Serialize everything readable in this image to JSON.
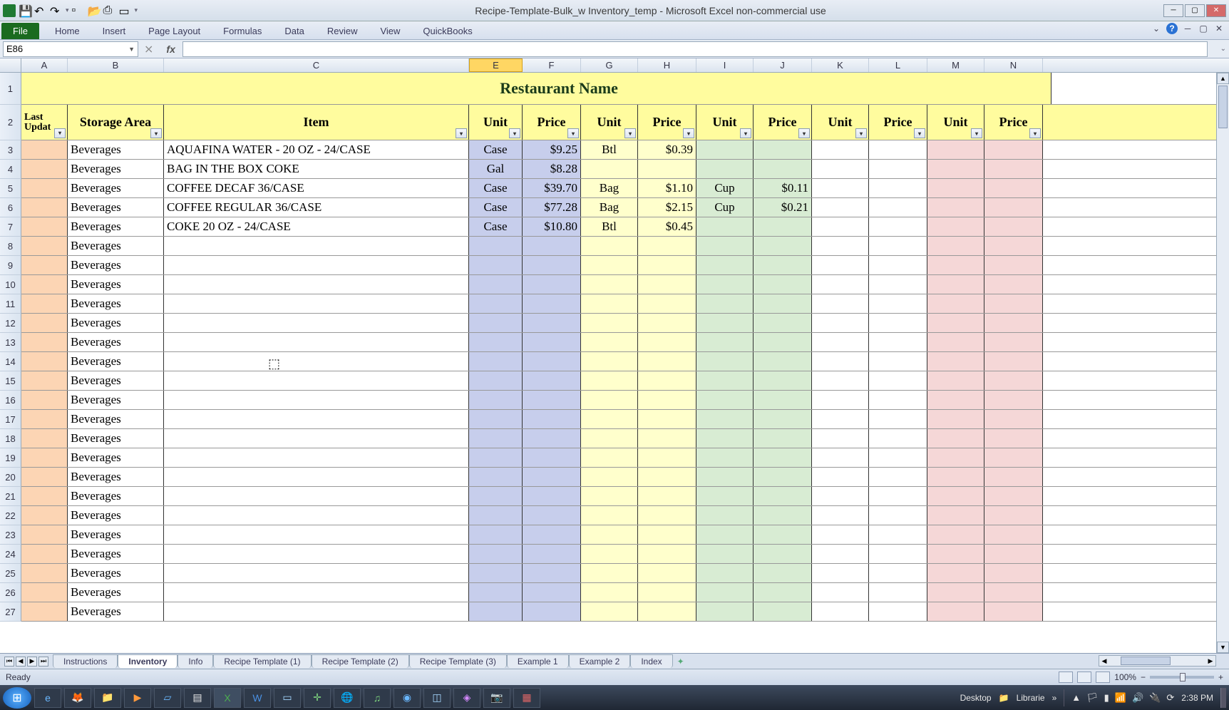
{
  "window": {
    "title": "Recipe-Template-Bulk_w Inventory_temp  -  Microsoft Excel non-commercial use"
  },
  "ribbon": {
    "file": "File",
    "tabs": [
      "Home",
      "Insert",
      "Page Layout",
      "Formulas",
      "Data",
      "Review",
      "View",
      "QuickBooks"
    ]
  },
  "formula": {
    "namebox": "E86",
    "fx": "fx",
    "value": ""
  },
  "columns": [
    "A",
    "B",
    "C",
    "E",
    "F",
    "G",
    "H",
    "I",
    "J",
    "K",
    "L",
    "M",
    "N"
  ],
  "selectedCol": "E",
  "title": "Restaurant Name",
  "headers": {
    "lastUpdate": "Last Updat",
    "storageArea": "Storage Area",
    "item": "Item",
    "unit": "Unit",
    "price": "Price"
  },
  "rows": [
    {
      "n": 3,
      "area": "Beverages",
      "item": "AQUAFINA WATER - 20 OZ - 24/CASE",
      "u1": "Case",
      "p1": "$9.25",
      "u2": "Btl",
      "p2": "$0.39",
      "u3": "",
      "p3": ""
    },
    {
      "n": 4,
      "area": "Beverages",
      "item": "BAG IN THE BOX COKE",
      "u1": "Gal",
      "p1": "$8.28",
      "u2": "",
      "p2": "",
      "u3": "",
      "p3": ""
    },
    {
      "n": 5,
      "area": "Beverages",
      "item": "COFFEE DECAF 36/CASE",
      "u1": "Case",
      "p1": "$39.70",
      "u2": "Bag",
      "p2": "$1.10",
      "u3": "Cup",
      "p3": "$0.11"
    },
    {
      "n": 6,
      "area": "Beverages",
      "item": "COFFEE REGULAR 36/CASE",
      "u1": "Case",
      "p1": "$77.28",
      "u2": "Bag",
      "p2": "$2.15",
      "u3": "Cup",
      "p3": "$0.21"
    },
    {
      "n": 7,
      "area": "Beverages",
      "item": "COKE 20 OZ - 24/CASE",
      "u1": "Case",
      "p1": "$10.80",
      "u2": "Btl",
      "p2": "$0.45",
      "u3": "",
      "p3": ""
    },
    {
      "n": 8,
      "area": "Beverages",
      "item": "",
      "u1": "",
      "p1": "",
      "u2": "",
      "p2": "",
      "u3": "",
      "p3": ""
    },
    {
      "n": 9,
      "area": "Beverages",
      "item": "",
      "u1": "",
      "p1": "",
      "u2": "",
      "p2": "",
      "u3": "",
      "p3": ""
    },
    {
      "n": 10,
      "area": "Beverages",
      "item": "",
      "u1": "",
      "p1": "",
      "u2": "",
      "p2": "",
      "u3": "",
      "p3": ""
    },
    {
      "n": 11,
      "area": "Beverages",
      "item": "",
      "u1": "",
      "p1": "",
      "u2": "",
      "p2": "",
      "u3": "",
      "p3": ""
    },
    {
      "n": 12,
      "area": "Beverages",
      "item": "",
      "u1": "",
      "p1": "",
      "u2": "",
      "p2": "",
      "u3": "",
      "p3": ""
    },
    {
      "n": 13,
      "area": "Beverages",
      "item": "",
      "u1": "",
      "p1": "",
      "u2": "",
      "p2": "",
      "u3": "",
      "p3": ""
    },
    {
      "n": 14,
      "area": "Beverages",
      "item": "",
      "u1": "",
      "p1": "",
      "u2": "",
      "p2": "",
      "u3": "",
      "p3": ""
    },
    {
      "n": 15,
      "area": "Beverages",
      "item": "",
      "u1": "",
      "p1": "",
      "u2": "",
      "p2": "",
      "u3": "",
      "p3": ""
    },
    {
      "n": 16,
      "area": "Beverages",
      "item": "",
      "u1": "",
      "p1": "",
      "u2": "",
      "p2": "",
      "u3": "",
      "p3": ""
    },
    {
      "n": 17,
      "area": "Beverages",
      "item": "",
      "u1": "",
      "p1": "",
      "u2": "",
      "p2": "",
      "u3": "",
      "p3": ""
    },
    {
      "n": 18,
      "area": "Beverages",
      "item": "",
      "u1": "",
      "p1": "",
      "u2": "",
      "p2": "",
      "u3": "",
      "p3": ""
    },
    {
      "n": 19,
      "area": "Beverages",
      "item": "",
      "u1": "",
      "p1": "",
      "u2": "",
      "p2": "",
      "u3": "",
      "p3": ""
    },
    {
      "n": 20,
      "area": "Beverages",
      "item": "",
      "u1": "",
      "p1": "",
      "u2": "",
      "p2": "",
      "u3": "",
      "p3": ""
    },
    {
      "n": 21,
      "area": "Beverages",
      "item": "",
      "u1": "",
      "p1": "",
      "u2": "",
      "p2": "",
      "u3": "",
      "p3": ""
    },
    {
      "n": 22,
      "area": "Beverages",
      "item": "",
      "u1": "",
      "p1": "",
      "u2": "",
      "p2": "",
      "u3": "",
      "p3": ""
    },
    {
      "n": 23,
      "area": "Beverages",
      "item": "",
      "u1": "",
      "p1": "",
      "u2": "",
      "p2": "",
      "u3": "",
      "p3": ""
    },
    {
      "n": 24,
      "area": "Beverages",
      "item": "",
      "u1": "",
      "p1": "",
      "u2": "",
      "p2": "",
      "u3": "",
      "p3": ""
    },
    {
      "n": 25,
      "area": "Beverages",
      "item": "",
      "u1": "",
      "p1": "",
      "u2": "",
      "p2": "",
      "u3": "",
      "p3": ""
    },
    {
      "n": 26,
      "area": "Beverages",
      "item": "",
      "u1": "",
      "p1": "",
      "u2": "",
      "p2": "",
      "u3": "",
      "p3": ""
    },
    {
      "n": 27,
      "area": "Beverages",
      "item": "",
      "u1": "",
      "p1": "",
      "u2": "",
      "p2": "",
      "u3": "",
      "p3": ""
    }
  ],
  "sheets": [
    "Instructions",
    "Inventory",
    "Info",
    "Recipe Template (1)",
    "Recipe Template (2)",
    "Recipe Template (3)",
    "Example 1",
    "Example 2",
    "Index"
  ],
  "activeSheet": "Inventory",
  "status": {
    "ready": "Ready",
    "zoom": "100%"
  },
  "taskbar": {
    "desktop": "Desktop",
    "libraries": "Librarie",
    "time": "2:38 PM"
  }
}
